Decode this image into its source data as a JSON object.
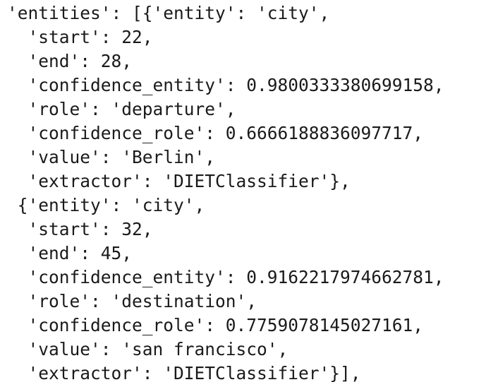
{
  "code": {
    "lines": [
      "'entities': [{'entity': 'city',",
      "  'start': 22,",
      "  'end': 28,",
      "  'confidence_entity': 0.9800333380699158,",
      "  'role': 'departure',",
      "  'confidence_role': 0.6666188836097717,",
      "  'value': 'Berlin',",
      "  'extractor': 'DIETClassifier'},",
      " {'entity': 'city',",
      "  'start': 32,",
      "  'end': 45,",
      "  'confidence_entity': 0.9162217974662781,",
      "  'role': 'destination',",
      "  'confidence_role': 0.7759078145027161,",
      "  'value': 'san francisco',",
      "  'extractor': 'DIETClassifier'}],"
    ]
  }
}
